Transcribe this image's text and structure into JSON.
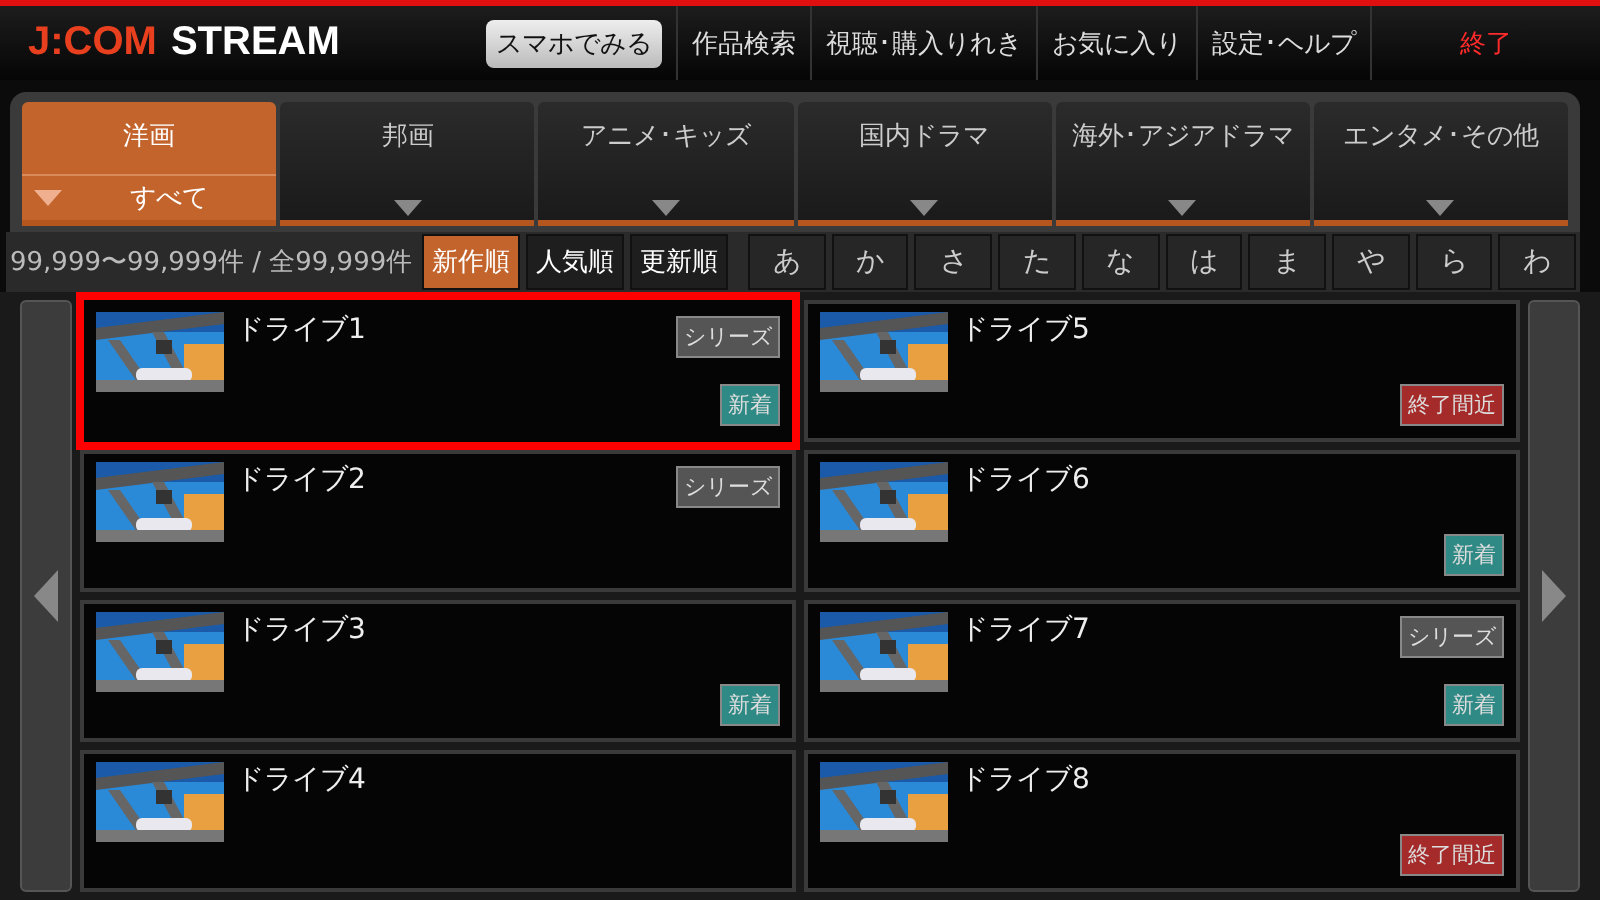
{
  "header": {
    "logo": {
      "brand": "J:COM",
      "product": "STREAM"
    },
    "menu": [
      {
        "label": "スマホでみる",
        "kind": "pill"
      },
      {
        "label": "作品検索",
        "kind": "item"
      },
      {
        "label": "視聴･購入りれき",
        "kind": "item"
      },
      {
        "label": "お気に入り",
        "kind": "item"
      },
      {
        "label": "設定･ヘルプ",
        "kind": "item"
      },
      {
        "label": "終了",
        "kind": "exit"
      }
    ]
  },
  "categories": [
    {
      "label": "洋画",
      "selected": true,
      "sub": "すべて"
    },
    {
      "label": "邦画",
      "selected": false
    },
    {
      "label": "アニメ･キッズ",
      "selected": false
    },
    {
      "label": "国内ドラマ",
      "selected": false
    },
    {
      "label": "海外･アジアドラマ",
      "selected": false
    },
    {
      "label": "エンタメ･その他",
      "selected": false
    }
  ],
  "count": "99,999〜99,999件 / 全99,999件",
  "sort": [
    {
      "label": "新作順",
      "selected": true
    },
    {
      "label": "人気順",
      "selected": false
    },
    {
      "label": "更新順",
      "selected": false
    }
  ],
  "kana": [
    "あ",
    "か",
    "さ",
    "た",
    "な",
    "は",
    "ま",
    "や",
    "ら",
    "わ"
  ],
  "titles": [
    {
      "title": "ドライブ1",
      "selected": true,
      "badges": [
        {
          "kind": "series",
          "label": "シリーズ"
        },
        {
          "kind": "new",
          "label": "新着"
        }
      ]
    },
    {
      "title": "ドライブ2",
      "selected": false,
      "badges": [
        {
          "kind": "series",
          "label": "シリーズ"
        }
      ]
    },
    {
      "title": "ドライブ3",
      "selected": false,
      "badges": [
        {
          "kind": "new",
          "label": "新着"
        }
      ]
    },
    {
      "title": "ドライブ4",
      "selected": false
    },
    {
      "title": "ドライブ5",
      "selected": false,
      "badges": [
        {
          "kind": "ending",
          "label": "終了間近"
        }
      ]
    },
    {
      "title": "ドライブ6",
      "selected": false,
      "badges": [
        {
          "kind": "new",
          "label": "新着"
        }
      ]
    },
    {
      "title": "ドライブ7",
      "selected": false,
      "badges": [
        {
          "kind": "series",
          "label": "シリーズ"
        },
        {
          "kind": "new",
          "label": "新着"
        }
      ]
    },
    {
      "title": "ドライブ8",
      "selected": false,
      "badges": [
        {
          "kind": "ending",
          "label": "終了間近"
        }
      ]
    }
  ]
}
